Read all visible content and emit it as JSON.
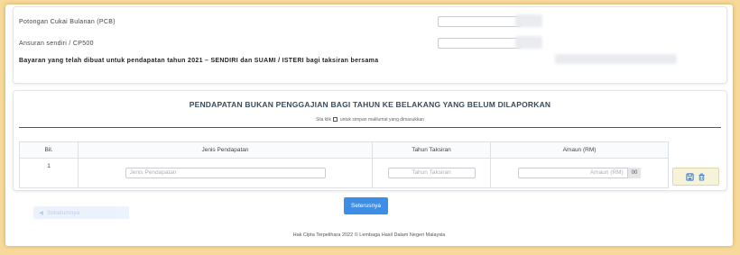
{
  "top_section": {
    "pcb_label": "Potongan Cukai Bulanan (PCB)",
    "cp500_label": "Ansuran sendiri / CP500",
    "payment_note": "Bayaran yang telah dibuat untuk pendapatan tahun 2021 – SENDIRI dan SUAMI / ISTERI bagi taksiran bersama"
  },
  "main_section": {
    "title": "PENDAPATAN BUKAN PENGGAJIAN BAGI TAHUN KE BELAKANG YANG BELUM DILAPORKAN",
    "instruction_before": "Sila klik",
    "instruction_after": "untuk simpan maklumat yang dimasukkan",
    "table": {
      "headers": [
        "Bil.",
        "Jenis Pendapatan",
        "Tahun Taksiran",
        "Amaun (RM)"
      ],
      "rows": [
        {
          "bil": "1",
          "jenis_placeholder": "Jenis Pendapatan",
          "tahun_placeholder": "Tahun Taksiran",
          "amaun_placeholder": "Amaun (RM)",
          "amaun_suffix": "00"
        }
      ]
    }
  },
  "actions": {
    "next_label": "Seterusnya",
    "back_label": "Sebelumnya"
  },
  "footer": {
    "copyright": "Hak Cipta Terpelihara 2022 © Lembaga Hasil Dalam Negeri Malaysia"
  },
  "icons": {
    "save": "save-icon",
    "delete": "trash-icon"
  },
  "colors": {
    "primary_button": "#3f8ee6",
    "action_icons": "#3f7fd0",
    "page_background": "#f7d99a"
  }
}
